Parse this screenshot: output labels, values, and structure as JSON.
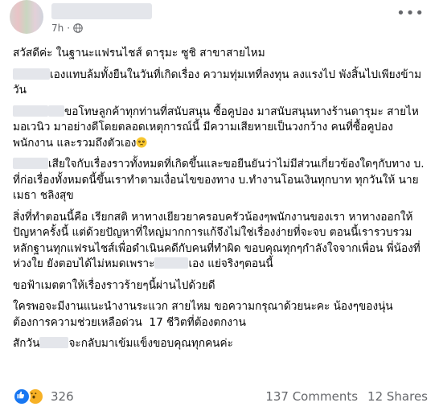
{
  "post": {
    "time": "7h",
    "paragraphs": [
      {
        "segments": [
          "สวัสดีค่ะ ในฐานะแฟรนไชส์ ดารุมะ ซูชิ สาขาสายไหม"
        ]
      },
      {
        "segments": [
          "",
          "เองแทบล้มทั้งยืนในวันที่เกิดเรื่อง ความทุ่มเทที่ลงทุน ลงแรงไป พังสิ้นไปเพียงข้ามวัน"
        ],
        "blur_first": 46
      },
      {
        "segments": [
          "",
          "ขอโทษลูกค้าทุกท่านที่สนับสนุน ซื้อคูปอง มาสนับสนุนทางร้านดารุมะ สายไหมอเวนิว มาอย่างดีโดยตลอดเหตุการณ์นี้ มีความเสียหายเป็นวงกว้าง คนที่ซื้อคูปอง พนักงาน และรวมถึงตัว",
          "เอง"
        ],
        "blur_first": 44,
        "blur_mid": 20,
        "emoji_end": "pleading-face-emoji"
      },
      {
        "segments": [
          "",
          "เสียใจกับเรื่องราวทั้งหมดที่เกิดขึ้นและขอยืนยันว่าไม่มีส่วนเกี่ยวข้องใดๆกับทาง บ. ที่ก่อเรื่องทั้งหมดนี้ขึ้นเราทำตามเงื่อนไขของทาง บ.ทำงานโอนเงินทุกบาท ทุกวันให้ นาย เมธา ชลิงสุข"
        ],
        "blur_first": 44
      },
      {
        "segments": [
          "สิ่งที่ทำตอนนี้คือ เรียกสติ หาทางเยียวยาครอบครัวน้องๆพนักงานของเรา หาทางออกให้ปัญหาครั้งนี้ แต่ด้วยปัญหาที่ใหญ่มากการแก้จึงไม่ใช่เรื่องง่ายที่จะจบ ตอนนี้เรารวบรวมหลักฐานทุกแฟรนไชส์เพื่อดำเนินคดีกับคนที่ทำผิด ขอบคุณทุกๆกำลังใจจากเพื่อน พี่น้องที่ห่วงใย ยังตอบได้ไม่หมดเพราะ",
          "เอง แย่จริงๆตอนนี้"
        ],
        "blur_mid": 42
      },
      {
        "segments": [
          "ขอฟ้าเมตตาให้เรื่องราวร้ายๆนี้ผ่านไปด้วยดี"
        ]
      },
      {
        "segments": [
          "ใครพอจะมีงานแนะนำงานระแวก สายไหม ขอความกรุณาด้วยนะคะ น้องๆของนุ่นต้องการความช่วยเหลือด่วน  17 ชีวิตที่ต้องตกงาน"
        ]
      },
      {
        "segments": [
          "สักวัน",
          "จะกลับมาเข้มแข็งขอบคุณทุกคนค่ะ"
        ],
        "blur_mid": 36
      }
    ]
  },
  "footer": {
    "reaction_count": "326",
    "comments": "137 Comments",
    "shares": "12 Shares",
    "colors": {
      "like": "#1877f2",
      "wow": "#f7b125",
      "muted": "#65676b"
    }
  }
}
